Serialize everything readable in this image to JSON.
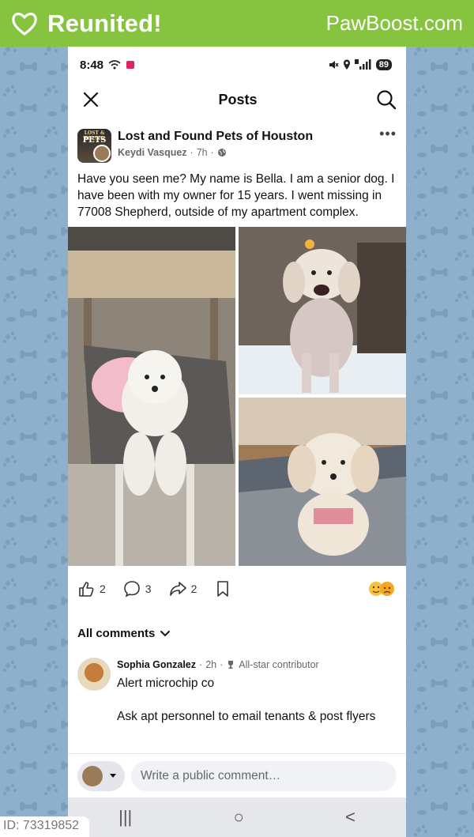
{
  "brand": {
    "title": "Reunited!",
    "url": "PawBoost.com",
    "color": "#86c440"
  },
  "status_bar": {
    "time": "8:48",
    "battery": "89"
  },
  "header": {
    "title": "Posts",
    "close_icon": "close-icon",
    "search_icon": "search-icon"
  },
  "post": {
    "group_name": "Lost and Found Pets of Houston",
    "author": "Keydi Vasquez",
    "time": "7h",
    "avatar_text_top": "LOST & FOUND",
    "avatar_text_main": "PETS",
    "text": "Have you seen me? My name is Bella. I am a senior dog. I have been with my owner for 15 years. I went missing in 77008 Shepherd, outside of my apartment complex."
  },
  "actions": {
    "likes": "2",
    "comments": "3",
    "shares": "2"
  },
  "comments_toggle": "All comments",
  "comment": {
    "name": "Sophia Gonzalez",
    "time": "2h",
    "badge": "All-star contributor",
    "line1": "Alert microchip co",
    "line2": "Ask apt personnel to email tenants & post flyers"
  },
  "composer": {
    "placeholder": "Write a public comment…"
  },
  "nav": {
    "recent": "|||",
    "home": "○",
    "back": "<"
  },
  "id_badge": "ID: 73319852"
}
